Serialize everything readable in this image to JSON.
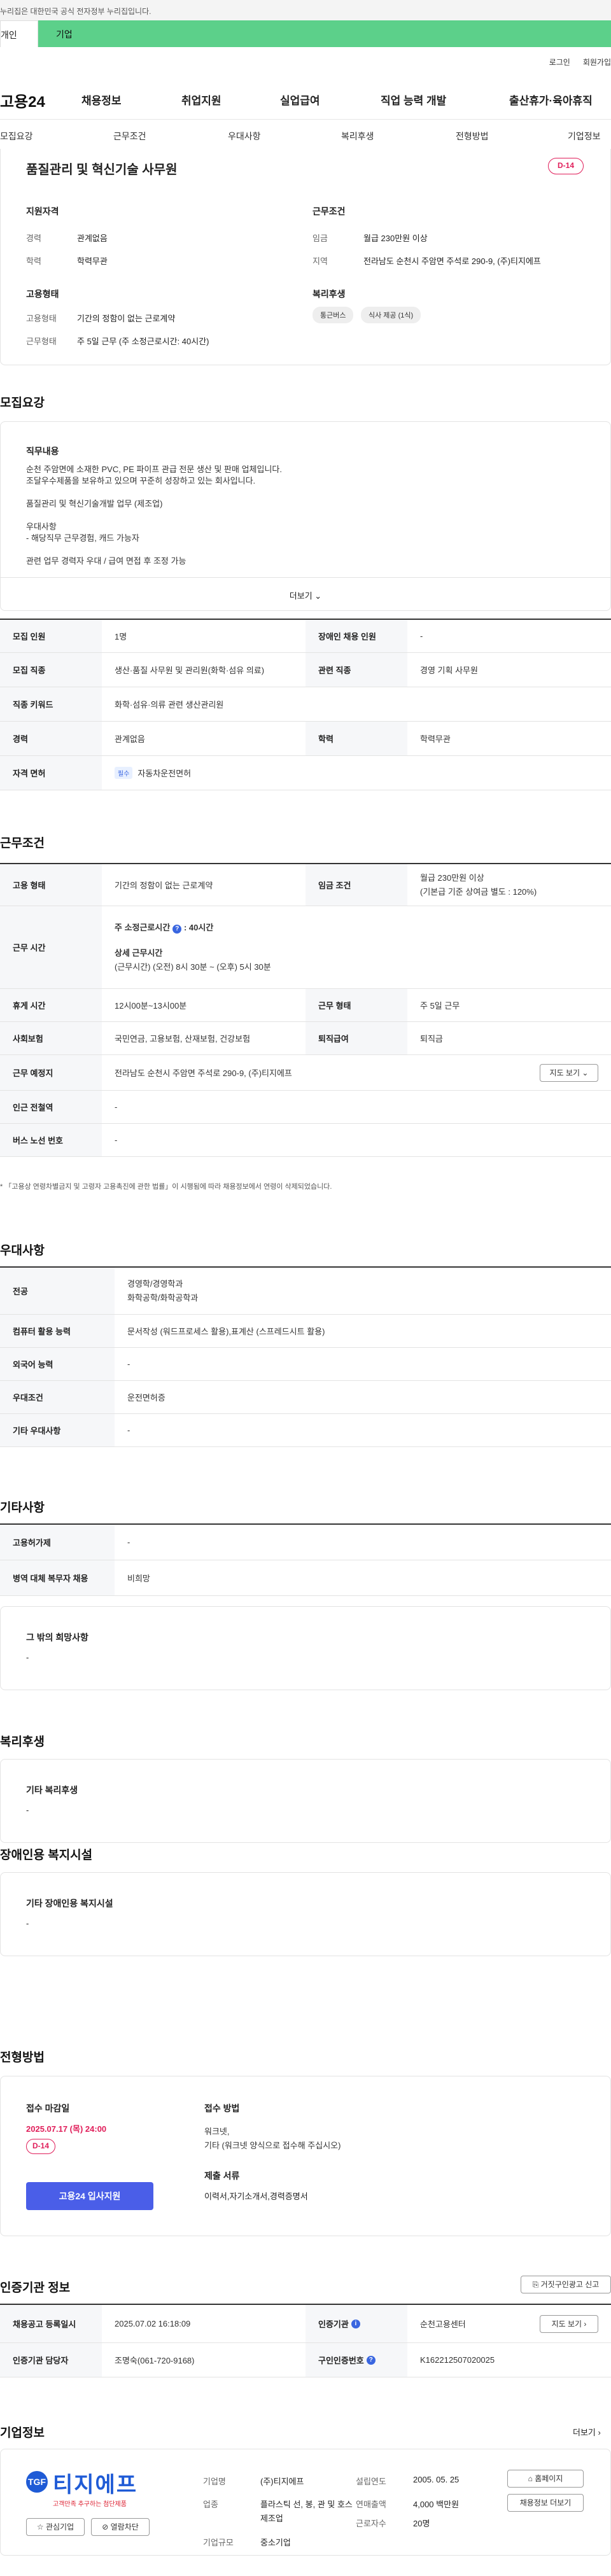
{
  "gov_bar": {
    "text": "누리집은 대한민국 공식 전자정부 누리집입니다."
  },
  "type_tabs": {
    "personal": "개인",
    "company": "기업"
  },
  "util": {
    "login": "로그인",
    "join": "회원가입"
  },
  "gnb": {
    "logo": "고용24",
    "items": [
      "채용정보",
      "취업지원",
      "실업급여",
      "직업 능력 개발",
      "출산휴가·육아휴직"
    ]
  },
  "subnav": [
    "모집요강",
    "근무조건",
    "우대사항",
    "복리후생",
    "전형방법",
    "기업정보"
  ],
  "summary": {
    "title": "품질관리 및 혁신기술 사무원",
    "dday": "D-14",
    "qual_title": "지원자격",
    "career_lbl": "경력",
    "career_val": "관계없음",
    "edu_lbl": "학력",
    "edu_val": "학력무관",
    "emp_title": "고용형태",
    "emp_lbl": "고용형태",
    "emp_val": "기간의 정함이 없는 근로계약",
    "work_lbl": "근무형태",
    "work_val": "주 5일 근무 (주 소정근로시간: 40시간)",
    "cond_title": "근무조건",
    "wage_lbl": "임금",
    "wage_val": "월급 230만원 이상",
    "region_lbl": "지역",
    "region_val": "전라남도 순천시 주암면 주석로 290-9, (주)티지에프",
    "welfare_title": "복리후생",
    "welfare_chips": [
      "통근버스",
      "식사 제공 (1식)"
    ]
  },
  "recruit": {
    "heading": "모집요강",
    "duty_title": "직무내용",
    "duty_lines": [
      "순천 주암면에 소재한 PVC, PE 파이프 관급 전문 생산 및 판매 업체입니다.",
      "조달우수제품을 보유하고 있으며 꾸준히 성장하고 있는 회사입니다.",
      "",
      "품질관리 및 혁신기술개발 업무 (제조업)",
      "",
      "우대사항",
      "- 해당직무 근무경험, 캐드 가능자",
      "",
      "관련 업무 경력자 우대 / 급여 면접 후 조정 가능"
    ],
    "more": "더보기",
    "table": {
      "count_lbl": "모집 인원",
      "count_val": "1명",
      "disabled_lbl": "장애인 채용 인원",
      "disabled_val": "-",
      "job_lbl": "모집 직종",
      "job_val": "생산·품질 사무원 및 관리원(화학·섬유 의료)",
      "rel_lbl": "관련 직종",
      "rel_val": "경영 기획 사무원",
      "kw_lbl": "직종 키워드",
      "kw_val": "화학·섬유·의류 관련 생산관리원",
      "career_lbl": "경력",
      "career_val": "관계없음",
      "edu_lbl": "학력",
      "edu_val": "학력무관",
      "lic_lbl": "자격 면허",
      "lic_tag": "필수",
      "lic_val": "자동차운전면허"
    }
  },
  "conditions": {
    "heading": "근무조건",
    "emp_lbl": "고용 형태",
    "emp_val": "기간의 정함이 없는 근로계약",
    "wage_lbl": "임금 조건",
    "wage_val": "월급 230만원 이상",
    "wage_sub": "(기본급 기준 상여금 별도 : 120%)",
    "hours_lbl": "근무 시간",
    "hours_main_lbl": "주 소정근로시간",
    "hours_main_val": ": 40시간",
    "hours_detail_lbl": "상세 근무시간",
    "hours_detail_val": "(근무시간) (오전) 8시 30분 ~ (오후) 5시 30분",
    "break_lbl": "휴게 시간",
    "break_val": "12시00분~13시00분",
    "worktype_lbl": "근무 형태",
    "worktype_val": "주 5일 근무",
    "ins_lbl": "사회보험",
    "ins_val": "국민연금, 고용보험, 산재보험, 건강보험",
    "ret_lbl": "퇴직급여",
    "ret_val": "퇴직금",
    "place_lbl": "근무 예정지",
    "place_val": "전라남도 순천시 주암면 주석로 290-9, (주)티지에프",
    "map_btn": "지도 보기",
    "sub_lbl": "인근 전철역",
    "sub_val": "-",
    "bus_lbl": "버스 노선 번호",
    "bus_val": "-",
    "note": "* 「고용상 연령차별금지 및 고령자 고용촉진에 관한 법률」이 시행됨에 따라 채용정보에서 연령이 삭제되었습니다."
  },
  "preference": {
    "heading": "우대사항",
    "major_lbl": "전공",
    "major_vals": [
      "경영학/경영학과",
      "화학공학/화학공학과"
    ],
    "computer_lbl": "컴퓨터 활용 능력",
    "computer_val": "문서작성 (워드프로세스 활용),표계산 (스프레드시트 활용)",
    "lang_lbl": "외국어 능력",
    "lang_val": "-",
    "cond_lbl": "우대조건",
    "cond_val": "운전면허증",
    "etc_lbl": "기타 우대사항",
    "etc_val": "-"
  },
  "etc": {
    "heading": "기타사항",
    "subsidy_lbl": "고용허가제",
    "subsidy_val": "-",
    "military_lbl": "병역 대체 복무자 채용",
    "military_val": "비희망",
    "other_title": "그 밖의 희망사항",
    "other_val": "-"
  },
  "welfare": {
    "heading": "복리후생",
    "title": "기타 복리후생",
    "val": "-"
  },
  "disabled": {
    "heading": "장애인용 복지시설",
    "title": "기타 장애인용 복지시설",
    "val": "-"
  },
  "process": {
    "heading": "전형방법",
    "deadline_title": "접수 마감일",
    "deadline_val": "2025.07.17 (목) 24:00",
    "dday": "D-14",
    "apply_btn": "고용24 입사지원",
    "method_title": "접수 방법",
    "method_lines": [
      "워크넷,",
      "기타 (워크넷 양식으로 접수해 주십시오)"
    ],
    "docs_title": "제출 서류",
    "docs_val": "이력서,자기소개서,경력증명서"
  },
  "agency": {
    "heading": "인증기관 정보",
    "report_btn": "거짓구인광고 신고",
    "reg_lbl": "채용공고 등록일시",
    "reg_val": "2025.07.02 16:18:09",
    "agency_lbl": "인증기관",
    "agency_val": "순천고용센터",
    "map_btn": "지도 보기",
    "manager_lbl": "인증기관 담당자",
    "manager_val": "조명숙(061-720-9168)",
    "job_no_lbl": "구인인증번호",
    "job_no_val": "K162212507020025"
  },
  "company": {
    "heading": "기업정보",
    "more": "더보기",
    "logo_text": "티지에프",
    "logo_sub": "고객만족 추구하는 첨단제품",
    "fav_btn": "관심기업",
    "block_btn": "열람차단",
    "name_lbl": "기업명",
    "name_val": "(주)티지에프",
    "ind_lbl": "업종",
    "ind_val": "플라스틱 선, 봉, 관 및 호스 제조업",
    "scale_lbl": "기업규모",
    "scale_val": "중소기업",
    "est_lbl": "설립연도",
    "est_val": "2005. 05. 25",
    "sales_lbl": "연매출액",
    "sales_val": "4,000 백만원",
    "emp_lbl": "근로자수",
    "emp_val": "20명",
    "home_btn": "홈페이지",
    "jobs_btn": "채용정보 더보기"
  }
}
